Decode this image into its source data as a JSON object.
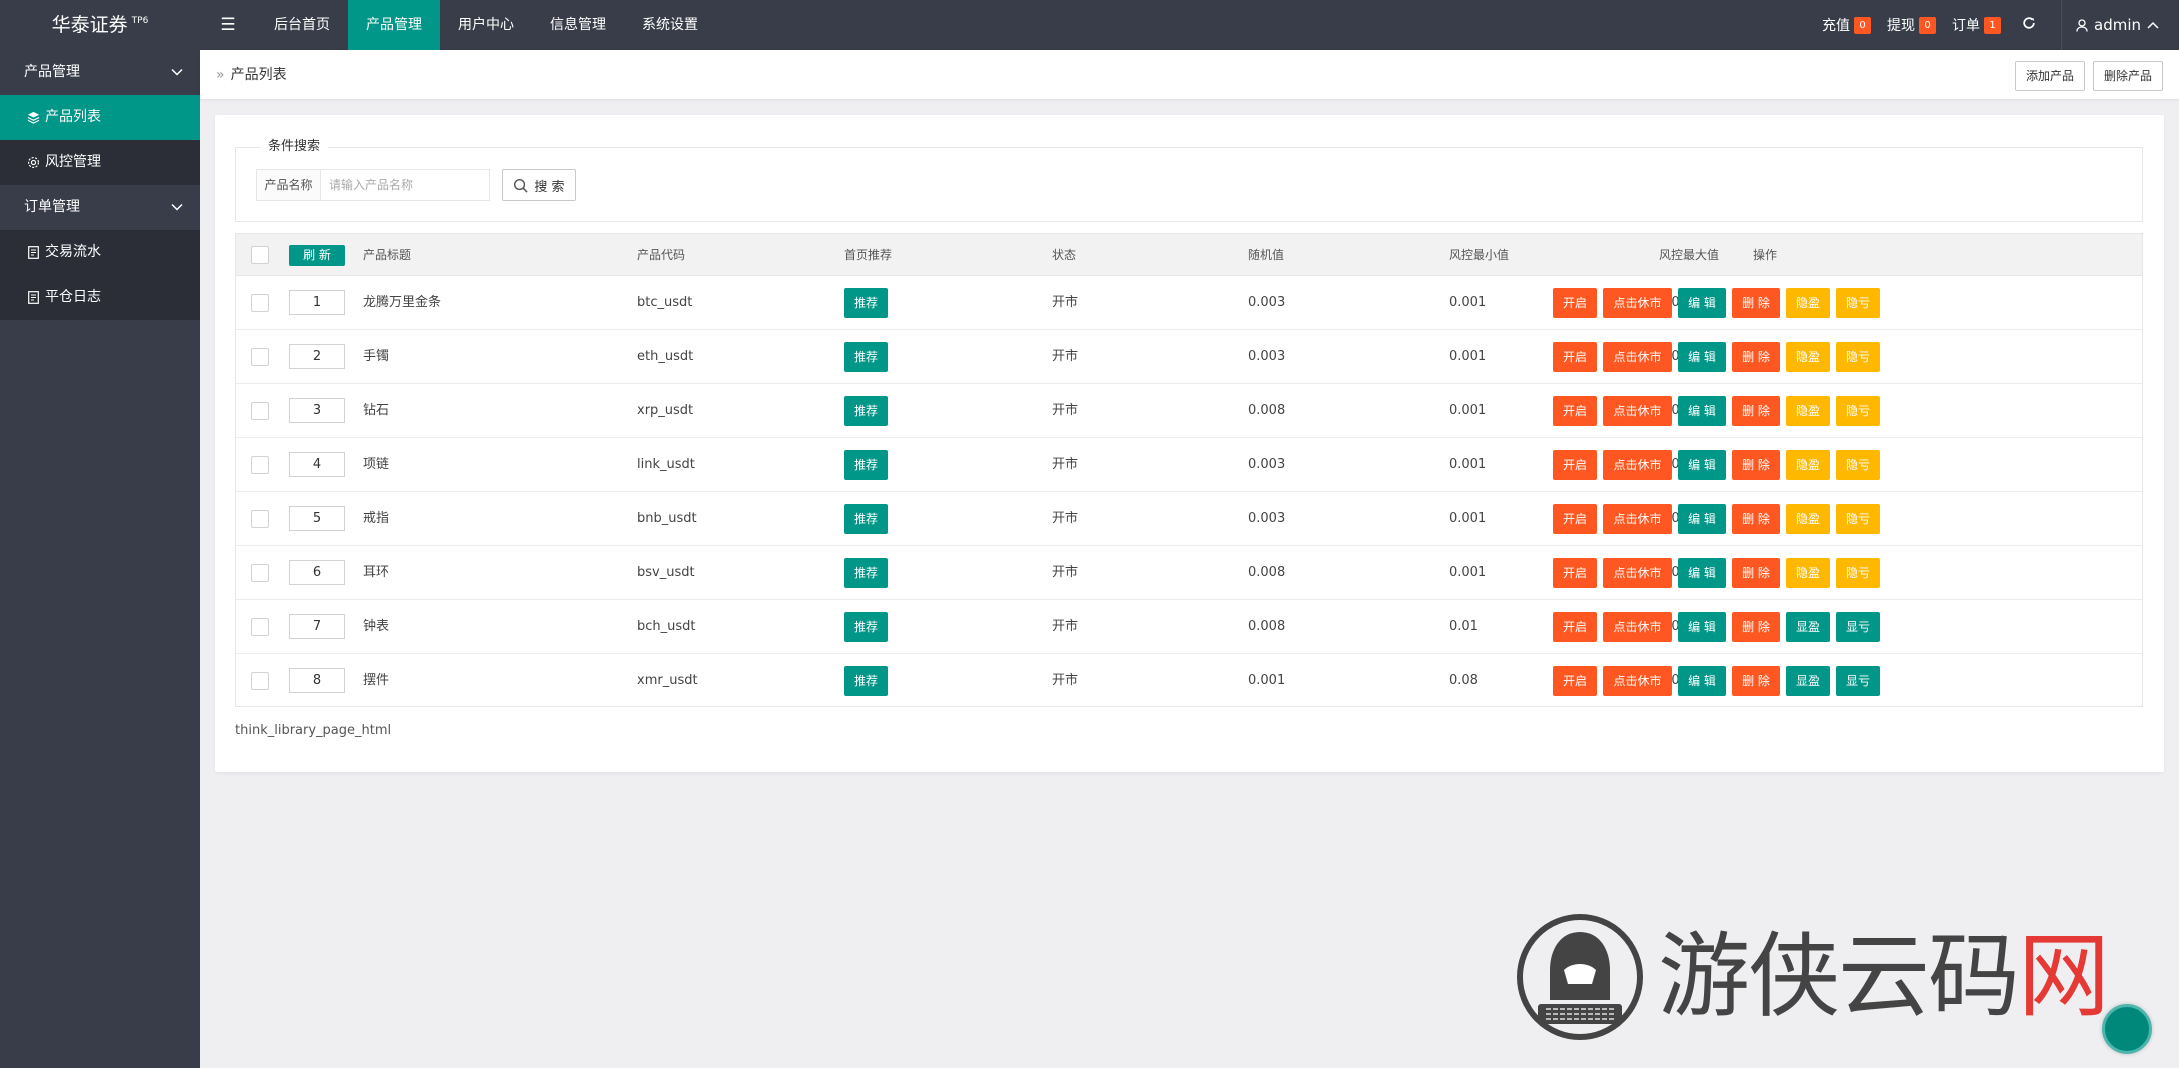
{
  "brand": {
    "name": "华泰证券",
    "version": "TP6"
  },
  "topnav": [
    {
      "label": "后台首页",
      "active": false
    },
    {
      "label": "产品管理",
      "active": true
    },
    {
      "label": "用户中心",
      "active": false
    },
    {
      "label": "信息管理",
      "active": false
    },
    {
      "label": "系统设置",
      "active": false
    }
  ],
  "topright": {
    "recharge": {
      "label": "充值",
      "count": "0"
    },
    "withdraw": {
      "label": "提现",
      "count": "0"
    },
    "orders": {
      "label": "订单",
      "count": "1"
    },
    "user": "admin"
  },
  "sidebar": {
    "groups": [
      {
        "label": "产品管理",
        "items": [
          {
            "label": "产品列表",
            "icon": "layers-icon",
            "active": true
          },
          {
            "label": "风控管理",
            "icon": "settings-icon",
            "active": false
          }
        ]
      },
      {
        "label": "订单管理",
        "items": [
          {
            "label": "交易流水",
            "icon": "document-icon",
            "active": false
          },
          {
            "label": "平仓日志",
            "icon": "document-icon",
            "active": false
          }
        ]
      }
    ]
  },
  "breadcrumb": {
    "separator": "»",
    "current": "产品列表"
  },
  "toolbar": {
    "add_label": "添加产品",
    "delete_label": "删除产品"
  },
  "search": {
    "legend": "条件搜索",
    "field_label": "产品名称",
    "placeholder": "请输入产品名称",
    "button_label": "搜 索"
  },
  "table": {
    "refresh_label": "刷 新",
    "headers": [
      "产品标题",
      "产品代码",
      "首页推荐",
      "状态",
      "随机值",
      "风控最小值",
      "风控最大值",
      "操作"
    ],
    "rows": [
      {
        "sort": "1",
        "title": "龙腾万里金条",
        "code": "btc_usdt",
        "recommend": "推荐",
        "status": "开市",
        "random": "0.003",
        "min": "0.001",
        "max": "0.005",
        "actions": [
          "开启",
          "点击休市",
          "编 辑",
          "删 除",
          "隐盈",
          "隐亏"
        ]
      },
      {
        "sort": "2",
        "title": "手镯",
        "code": "eth_usdt",
        "recommend": "推荐",
        "status": "开市",
        "random": "0.003",
        "min": "0.001",
        "max": "0.005",
        "actions": [
          "开启",
          "点击休市",
          "编 辑",
          "删 除",
          "隐盈",
          "隐亏"
        ]
      },
      {
        "sort": "3",
        "title": "钻石",
        "code": "xrp_usdt",
        "recommend": "推荐",
        "status": "开市",
        "random": "0.008",
        "min": "0.001",
        "max": "0.005",
        "actions": [
          "开启",
          "点击休市",
          "编 辑",
          "删 除",
          "隐盈",
          "隐亏"
        ]
      },
      {
        "sort": "4",
        "title": "项链",
        "code": "link_usdt",
        "recommend": "推荐",
        "status": "开市",
        "random": "0.003",
        "min": "0.001",
        "max": "0.005",
        "actions": [
          "开启",
          "点击休市",
          "编 辑",
          "删 除",
          "隐盈",
          "隐亏"
        ]
      },
      {
        "sort": "5",
        "title": "戒指",
        "code": "bnb_usdt",
        "recommend": "推荐",
        "status": "开市",
        "random": "0.003",
        "min": "0.001",
        "max": "0.005",
        "actions": [
          "开启",
          "点击休市",
          "编 辑",
          "删 除",
          "隐盈",
          "隐亏"
        ]
      },
      {
        "sort": "6",
        "title": "耳环",
        "code": "bsv_usdt",
        "recommend": "推荐",
        "status": "开市",
        "random": "0.008",
        "min": "0.001",
        "max": "0.005",
        "actions": [
          "开启",
          "点击休市",
          "编 辑",
          "删 除",
          "隐盈",
          "隐亏"
        ]
      },
      {
        "sort": "7",
        "title": "钟表",
        "code": "bch_usdt",
        "recommend": "推荐",
        "status": "开市",
        "random": "0.008",
        "min": "0.01",
        "max": "0.05",
        "actions": [
          "开启",
          "点击休市",
          "编 辑",
          "删 除",
          "显盈",
          "显亏"
        ]
      },
      {
        "sort": "8",
        "title": "摆件",
        "code": "xmr_usdt",
        "recommend": "推荐",
        "status": "开市",
        "random": "0.001",
        "min": "0.08",
        "max": "0.030",
        "actions": [
          "开启",
          "点击休市",
          "编 辑",
          "删 除",
          "显盈",
          "显亏"
        ]
      }
    ],
    "footnote": "think_library_page_html"
  },
  "watermark": {
    "text": "游侠云码",
    "accent": "网"
  },
  "colors": {
    "primary": "#009688",
    "danger": "#ff5722",
    "warm": "#ffb800",
    "dark": "#393d49"
  }
}
